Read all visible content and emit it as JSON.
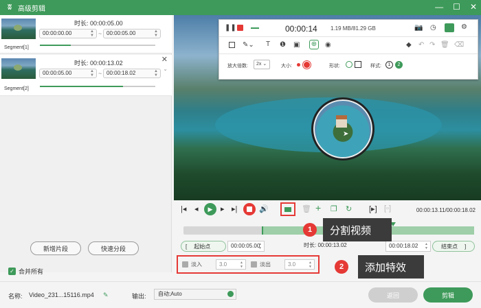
{
  "app": {
    "title": "高级剪辑",
    "logo": "frog-logo"
  },
  "segments": [
    {
      "name": "Segment[1]",
      "duration_label": "时长:",
      "duration": "00:00:05.00",
      "start": "00:00:00.00",
      "end": "00:00:05.00",
      "tilde": "~",
      "progress": 0.27
    },
    {
      "name": "Segment[2]",
      "duration_label": "时长:",
      "duration": "00:00:13.02",
      "start": "00:00:05.00",
      "end": "00:00:18.02",
      "tilde": "~",
      "progress": 0.72
    }
  ],
  "left_actions": {
    "add_segment": "新增片段",
    "quick_split": "快速分段",
    "merge_all": "合并所有"
  },
  "recorder": {
    "time": "00:00:14",
    "size": "1.19 MB/81.29 GB",
    "zoom_label": "放大倍数:",
    "zoom_value": "2x",
    "size_label": "大小:",
    "shape_label": "形状:",
    "style_label": "样式:",
    "style_1": "1",
    "style_2": "2"
  },
  "player": {
    "timecode": "00:00:13.11/00:00:18.02",
    "playhead_fraction": 0.72
  },
  "range": {
    "start_label": "起始点",
    "start_value": "00:00:05.00",
    "duration_label": "时长:",
    "duration_value": "00:00:13.02",
    "end_value": "00:00:18.02",
    "end_label": "结束点"
  },
  "effects": {
    "fade_in_label": "淡入",
    "fade_in_value": "3.0",
    "fade_out_label": "淡出",
    "fade_out_value": "3.0"
  },
  "callouts": [
    {
      "num": "1",
      "text": "分割视频"
    },
    {
      "num": "2",
      "text": "添加特效"
    }
  ],
  "footer": {
    "name_label": "名称:",
    "file_name": "Video_231...15116.mp4",
    "output_label": "输出:",
    "output_value": "自动;Auto",
    "back": "返回",
    "cut": "剪辑"
  },
  "colors": {
    "accent": "#3e9a5a",
    "highlight": "#e53935",
    "callout_bg": "#3b3b3b"
  }
}
